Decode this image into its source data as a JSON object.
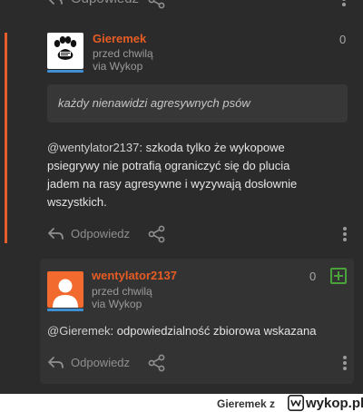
{
  "top_row": {
    "reply_label": "Odpowiedz"
  },
  "comment": {
    "author": "Gieremek",
    "time": "przed chwilą",
    "via": "via Wykop",
    "votes": "0",
    "quote": "każdy nienawidzi agresywnych psów",
    "mention": "@wentylator2137",
    "text_lines": [
      ": szkoda tylko że wykopowe",
      "psiegrywy nie potrafią ograniczyć się do plucia",
      "jadem na rasy agresywne i wyzywają dosłownie",
      "wszystkich."
    ],
    "reply_label": "Odpowiedz"
  },
  "reply": {
    "author": "wentylator2137",
    "time": "przed chwilą",
    "via": "via Wykop",
    "votes": "0",
    "mention": "@Gieremek",
    "text": ": odpowiedzialność zbiorowa wskazana",
    "reply_label": "Odpowiedz"
  },
  "footer": {
    "source": "Gieremek z",
    "logo_text": "wykop.pl"
  },
  "colors": {
    "accent": "#e65c24",
    "plus": "#4aa33a",
    "background": "#2b2b2b",
    "card": "#333333"
  },
  "icons": [
    "reply-icon",
    "share-icon",
    "more-icon",
    "plus-icon",
    "paw-avatar",
    "default-avatar"
  ]
}
